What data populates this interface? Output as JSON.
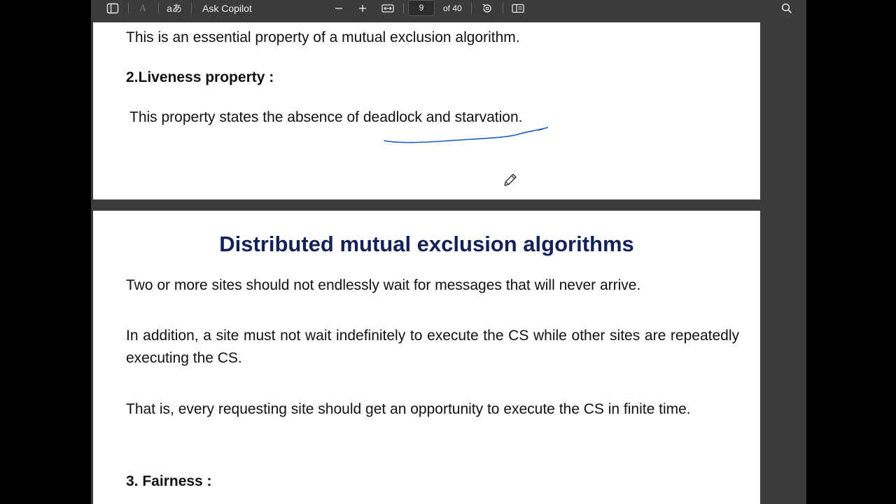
{
  "toolbar": {
    "ask_copilot": "Ask Copilot",
    "page_number": "9",
    "page_total": "of 40",
    "read_aloud_glyph": "A",
    "translate_glyph": "aあ",
    "icons": [
      "sidebar-toggle-icon",
      "read-aloud-icon",
      "translate-icon",
      "zoom-out-icon",
      "zoom-in-icon",
      "fit-width-icon",
      "rotate-icon",
      "page-view-icon",
      "search-icon"
    ]
  },
  "page1": {
    "line1": "This is an essential property of a mutual exclusion algorithm.",
    "heading": "2.Liveness property :",
    "line2": "This property states the absence of deadlock and starvation."
  },
  "page2": {
    "title": "Distributed mutual exclusion algorithms",
    "para1": "Two or more sites should not endlessly wait for messages that will never arrive.",
    "para2": "In addition, a site must not wait indefinitely to execute the CS while other sites are repeatedly executing the CS.",
    "para3": "That is, every requesting site should get an opportunity to execute the CS in finite time.",
    "heading": "3. Fairness :"
  },
  "colors": {
    "toolbar_bg": "#3b3b3b",
    "title_color": "#122257",
    "ink_color": "#1b5fbf"
  }
}
